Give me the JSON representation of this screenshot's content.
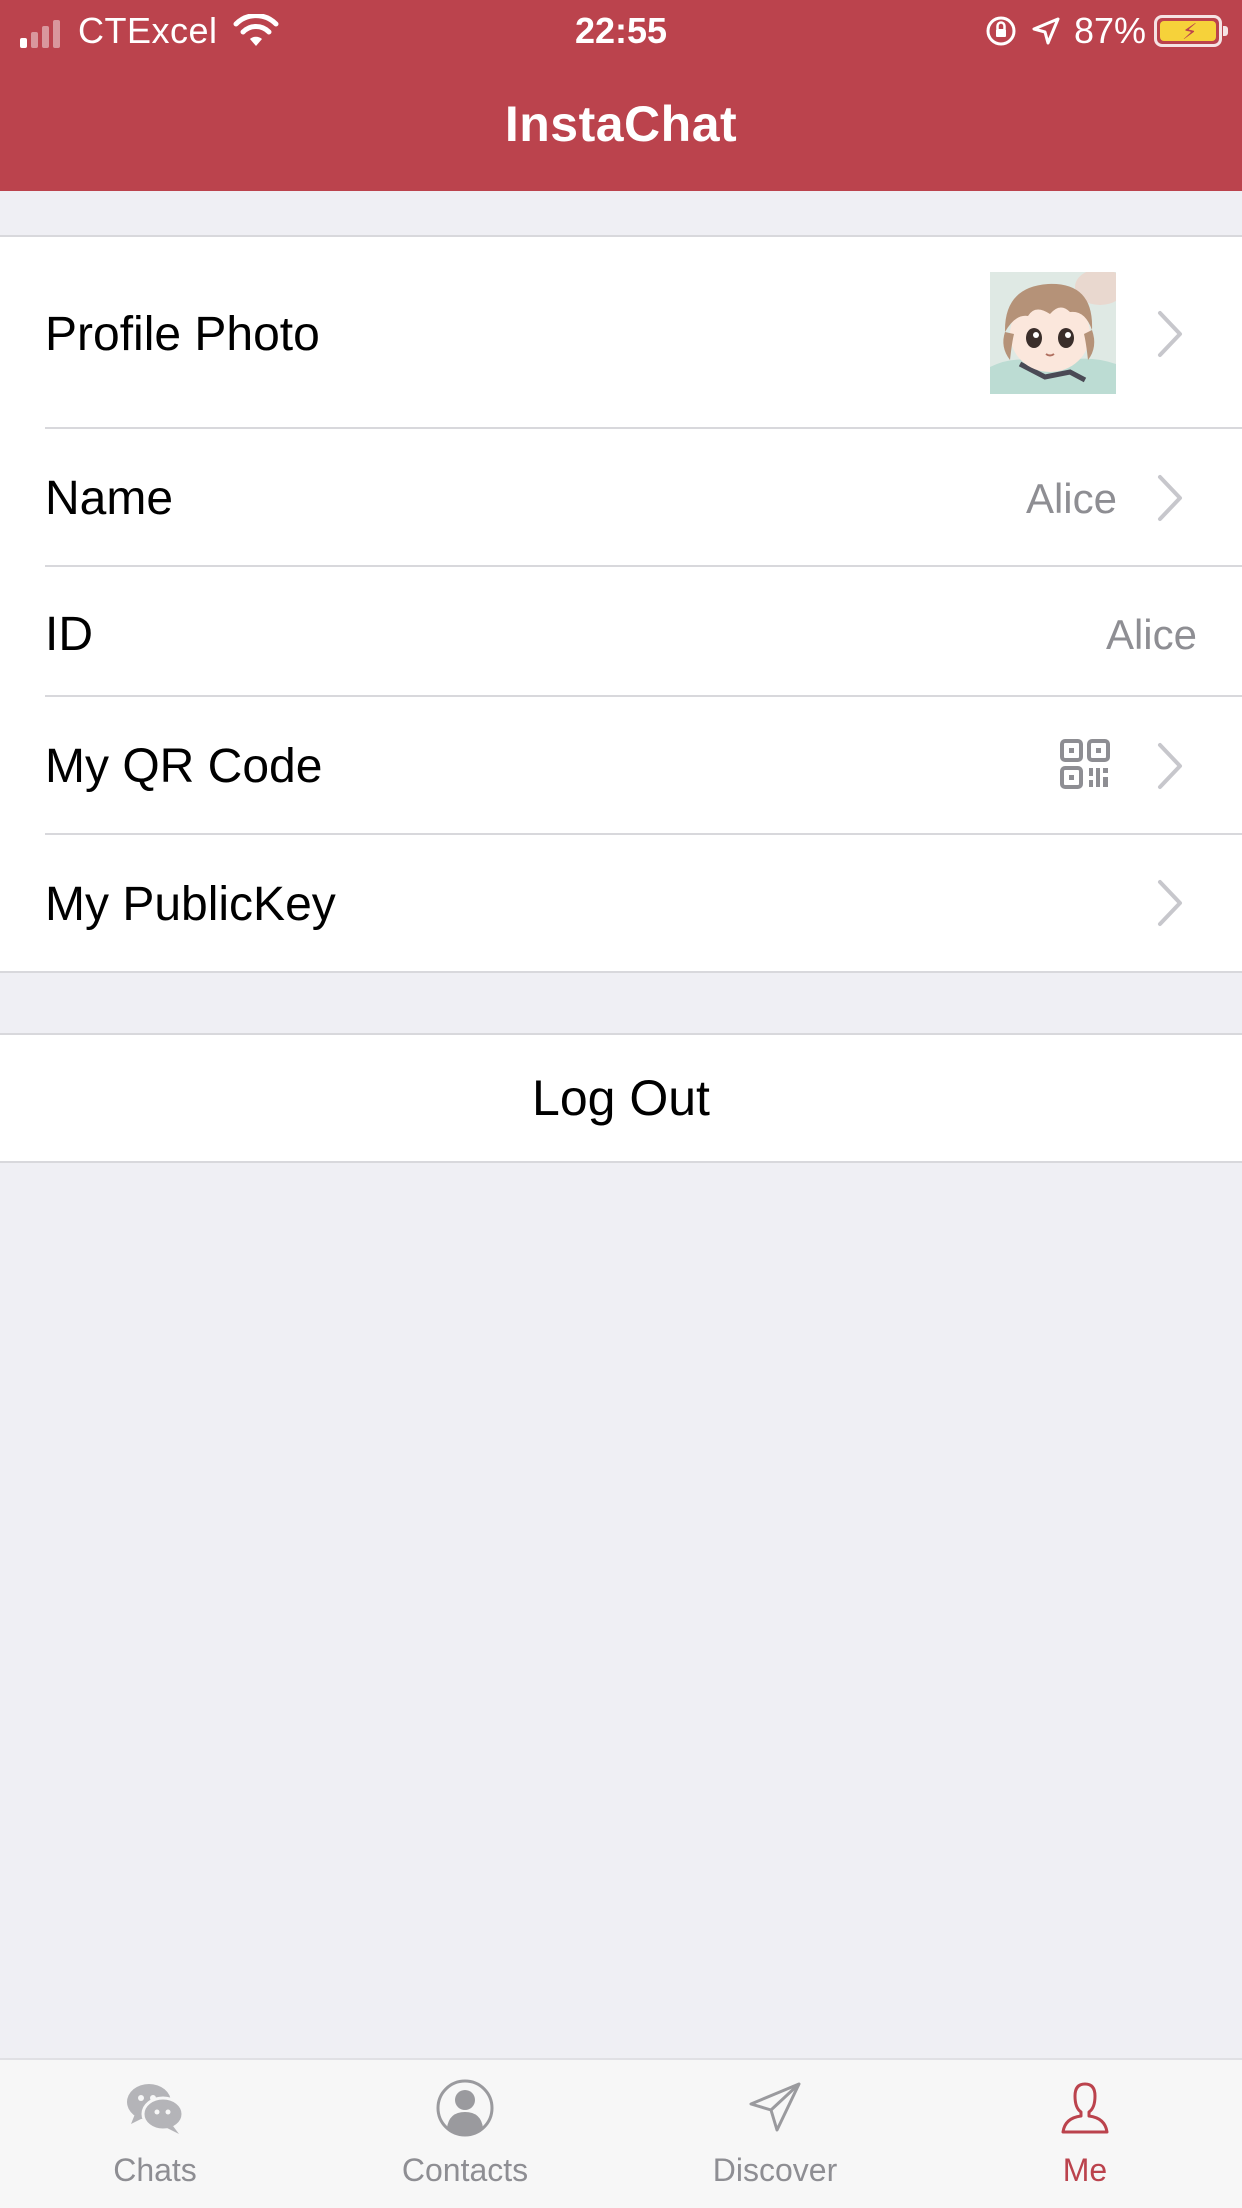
{
  "status_bar": {
    "carrier": "CTExcel",
    "time": "22:55",
    "battery_percent": "87%"
  },
  "header": {
    "title": "InstaChat"
  },
  "settings": {
    "profile_photo_label": "Profile Photo",
    "name_label": "Name",
    "name_value": "Alice",
    "id_label": "ID",
    "id_value": "Alice",
    "qr_label": "My QR Code",
    "publickey_label": "My PublicKey"
  },
  "logout_label": "Log Out",
  "tabs": [
    {
      "label": "Chats",
      "icon": "chat-bubbles-icon",
      "active": false
    },
    {
      "label": "Contacts",
      "icon": "contact-icon",
      "active": false
    },
    {
      "label": "Discover",
      "icon": "paper-plane-icon",
      "active": false
    },
    {
      "label": "Me",
      "icon": "person-icon",
      "active": true
    }
  ],
  "colors": {
    "brand": "#bb434d",
    "background": "#efeff4",
    "secondary_text": "#8e8e93"
  }
}
